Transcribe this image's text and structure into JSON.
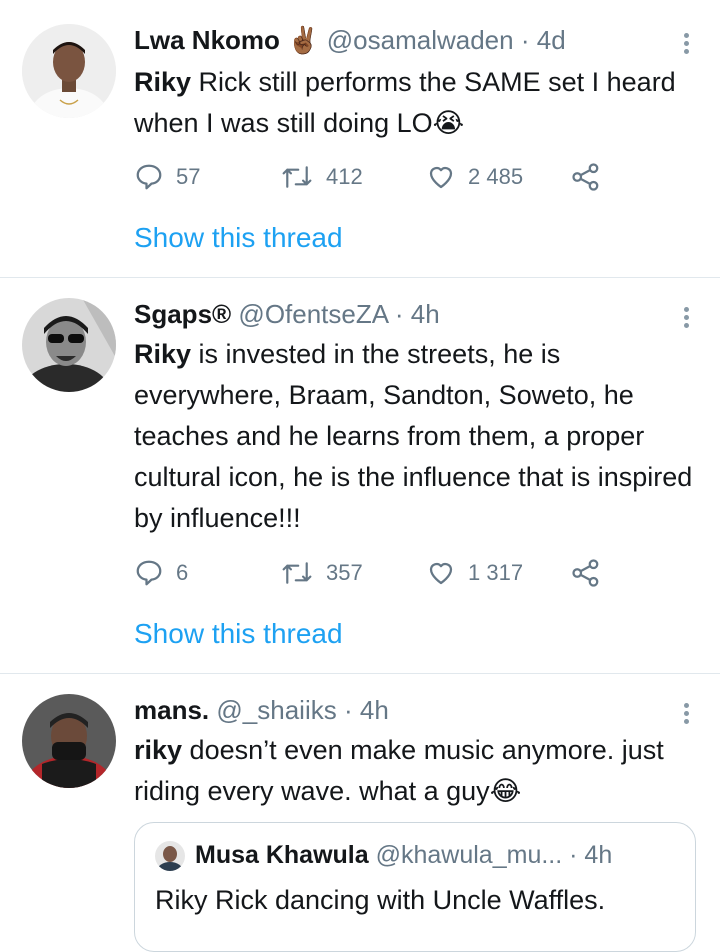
{
  "tweets": [
    {
      "name": "Lwa Nkomo",
      "name_emoji": "✌🏾",
      "handle": "@osamalwaden",
      "time": "4d",
      "text_bold": "Riky",
      "text": " Rick still performs the SAME set I heard when I was still doing LO",
      "text_emoji": "😭",
      "replies": "57",
      "retweets": "412",
      "likes": "2 485",
      "thread_link": "Show this thread"
    },
    {
      "name": "Sgaps®",
      "handle": "@OfentseZA",
      "time": "4h",
      "text_bold": "Riky",
      "text": " is invested in the streets, he is everywhere, Braam, Sandton, Soweto, he teaches and he learns from them, a proper cultural icon, he is the influence that is inspired by influence!!!",
      "replies": "6",
      "retweets": "357",
      "likes": "1 317",
      "thread_link": "Show this thread"
    },
    {
      "name": "mans.",
      "handle": "@_shaiiks",
      "time": "4h",
      "text_bold": "riky",
      "text": " doesn’t even make music anymore. just riding every wave. what a guy",
      "text_emoji": "😂",
      "quote": {
        "name": "Musa Khawula",
        "handle": "@khawula_mu...",
        "time": "4h",
        "text": "Riky Rick dancing with Uncle Waffles."
      }
    }
  ],
  "separator": "·",
  "icons": {
    "reply": "reply-icon",
    "retweet": "retweet-icon",
    "like": "heart-icon",
    "share": "share-icon",
    "more": "more-vertical-icon"
  },
  "colors": {
    "link": "#1da1f2",
    "muted": "#657786",
    "divider": "#e1e8ed"
  }
}
